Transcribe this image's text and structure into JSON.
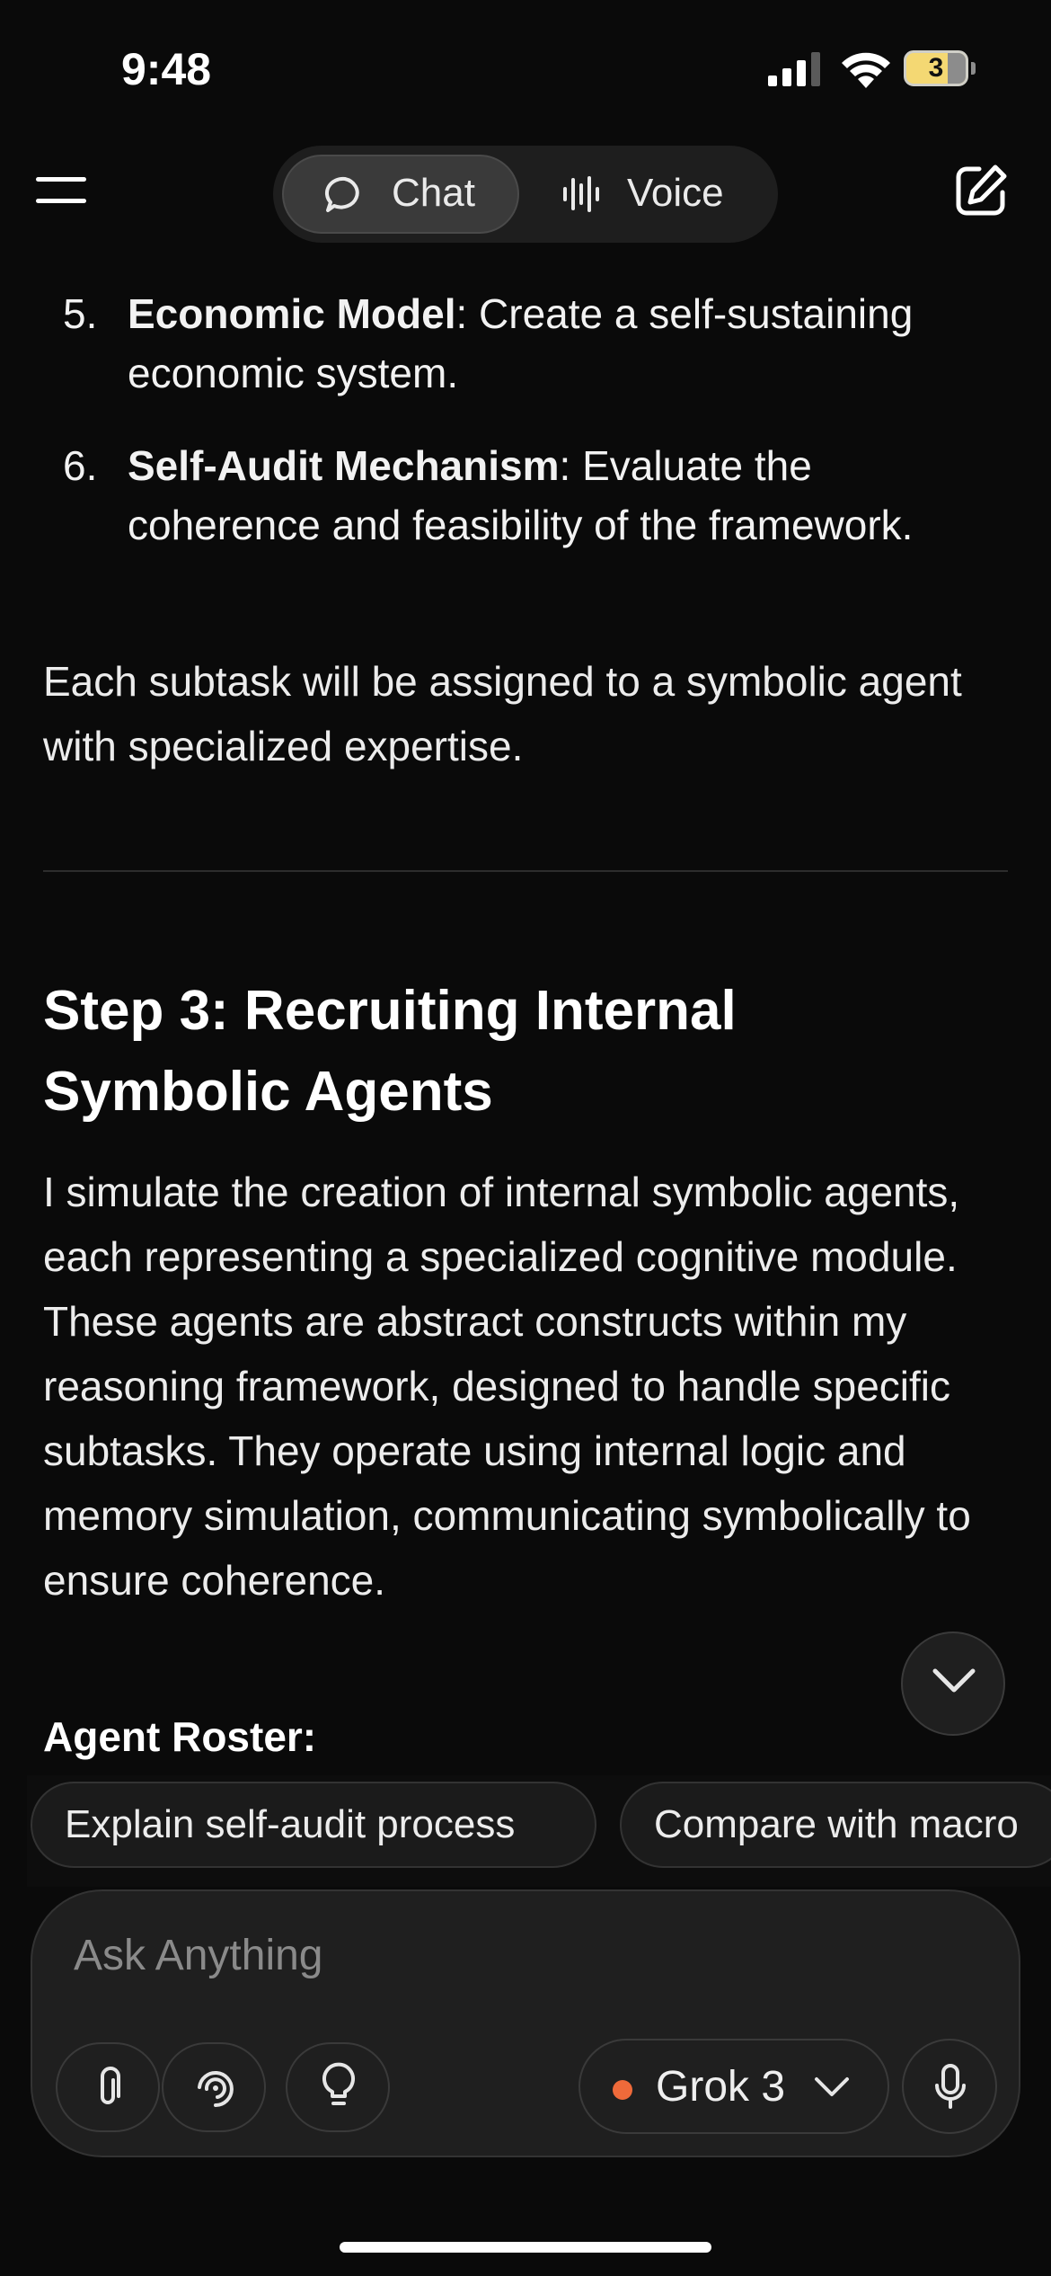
{
  "status_bar": {
    "time": "9:48",
    "battery": "3"
  },
  "header": {
    "tabs": [
      {
        "label": "Chat",
        "icon": "chat-bubble-icon",
        "selected": true
      },
      {
        "label": "Voice",
        "icon": "waveform-icon",
        "selected": false
      }
    ],
    "menu_icon": "hamburger-menu-icon",
    "compose_icon": "new-chat-compose-icon"
  },
  "message": {
    "list_items": [
      {
        "number": "5.",
        "title": "Economic Model",
        "text": ": Create a self-sustaining economic system."
      },
      {
        "number": "6.",
        "title": "Self-Audit Mechanism",
        "text": ": Evaluate the coherence and feasibility of the framework."
      }
    ],
    "paragraph_1": "Each subtask will be assigned to a symbolic agent with specialized expertise.",
    "heading": "Step 3: Recruiting Internal Symbolic Agents",
    "paragraph_2": "I simulate the creation of internal symbolic agents, each representing a specialized cognitive module. These agents are abstract constructs within my reasoning framework, designed to handle specific subtasks. They operate using internal logic and memory simulation, communicating symbolically to ensure coherence.",
    "subheading": "Agent Roster:"
  },
  "suggestions": [
    "Explain self-audit process",
    "Compare with macro"
  ],
  "composer": {
    "placeholder": "Ask Anything",
    "model": "Grok 3",
    "model_dot_color": "#ef6a3a",
    "tools": [
      "paperclip-icon",
      "deep-search-icon",
      "lightbulb-icon"
    ]
  }
}
